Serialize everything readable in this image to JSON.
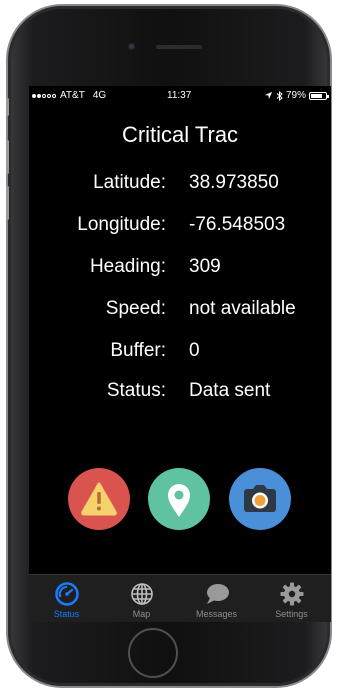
{
  "status_bar": {
    "signal_bars_filled": 2,
    "signal_bars_total": 5,
    "carrier": "AT&T",
    "network": "4G",
    "time": "11:37",
    "battery_percent": "79%",
    "battery_level": 0.79
  },
  "app": {
    "title": "Critical Trac"
  },
  "fields": [
    {
      "label": "Latitude:",
      "value": "38.973850"
    },
    {
      "label": "Longitude:",
      "value": "-76.548503"
    },
    {
      "label": "Heading:",
      "value": "309"
    },
    {
      "label": "Speed:",
      "value": "not available"
    },
    {
      "label": "Buffer:",
      "value": "0"
    },
    {
      "label": "Status:",
      "value": "Data sent"
    }
  ],
  "actions": [
    {
      "icon": "warning-icon",
      "color": "#d9534f"
    },
    {
      "icon": "location-pin-icon",
      "color": "#5fc2a0"
    },
    {
      "icon": "camera-icon",
      "color": "#4a90d9"
    }
  ],
  "tabs": [
    {
      "label": "Status",
      "icon": "gauge-icon",
      "active": true
    },
    {
      "label": "Map",
      "icon": "globe-icon",
      "active": false
    },
    {
      "label": "Messages",
      "icon": "chat-bubble-icon",
      "active": false
    },
    {
      "label": "Settings",
      "icon": "gear-icon",
      "active": false
    }
  ],
  "colors": {
    "accent": "#1a7cff",
    "tab_inactive": "#8e8e93",
    "tabbar_bg": "#1f1f1f",
    "screen_bg": "#000000"
  }
}
